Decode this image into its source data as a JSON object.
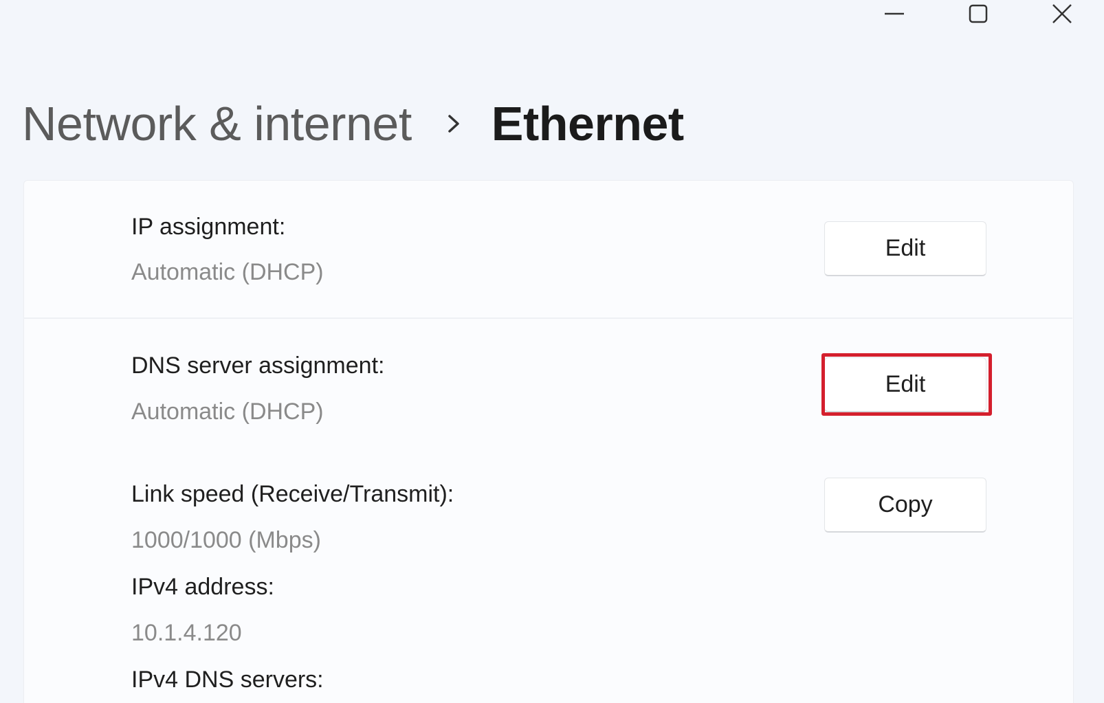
{
  "window_controls": {
    "minimize_icon": "minimize-icon",
    "maximize_icon": "maximize-icon",
    "close_icon": "close-icon"
  },
  "breadcrumb": {
    "parent": "Network & internet",
    "separator_icon": "chevron-right-icon",
    "current": "Ethernet"
  },
  "settings": {
    "ip_assignment": {
      "label": "IP assignment:",
      "value": "Automatic (DHCP)",
      "button": "Edit"
    },
    "dns_assignment": {
      "label": "DNS server assignment:",
      "value": "Automatic (DHCP)",
      "button": "Edit"
    },
    "properties": {
      "link_speed_label": "Link speed (Receive/Transmit):",
      "link_speed_value": "1000/1000 (Mbps)",
      "ipv4_address_label": "IPv4 address:",
      "ipv4_address_value": "10.1.4.120",
      "ipv4_dns_label": "IPv4 DNS servers:",
      "copy_button": "Copy"
    }
  },
  "colors": {
    "highlight": "#d41f2d",
    "background": "#f3f6fb",
    "card": "#fbfcfe"
  }
}
